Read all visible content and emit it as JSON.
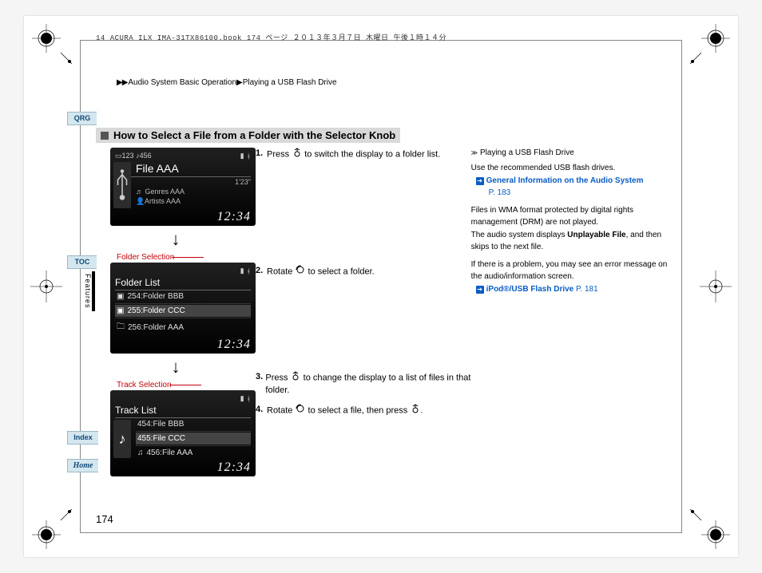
{
  "header_meta": "14 ACURA ILX IMA-31TX86100.book  174 ページ  ２０１３年３月７日  木曜日  午後１時１４分",
  "breadcrumb": {
    "arrows": "▶▶",
    "level1": "Audio System Basic Operation",
    "arrow2": "▶",
    "level2": "Playing a USB Flash Drive"
  },
  "tabs": {
    "qrg": "QRG",
    "toc": "TOC",
    "index": "Index",
    "home": "Home",
    "section_label": "Features"
  },
  "heading": "How to Select a File from a Folder with the Selector Knob",
  "steps": {
    "s1_num": "1.",
    "s1_a": "Press ",
    "s1_b": " to switch the display to a folder list.",
    "s2_num": "2.",
    "s2_a": "Rotate ",
    "s2_b": " to select a folder.",
    "s3_num": "3.",
    "s3_a": "Press ",
    "s3_b": " to change the display to a list of files in that folder.",
    "s4_num": "4.",
    "s4_a": "Rotate ",
    "s4_b": " to select a file, then press ",
    "s4_c": "."
  },
  "callouts": {
    "folder": "Folder Selection",
    "track": "Track Selection"
  },
  "screens": {
    "s1": {
      "counter_left": "123",
      "counter_right": "456",
      "file": "File AAA",
      "file_time": "1'23\"",
      "genres": "Genres AAA",
      "artists": "Artists AAA",
      "clock": "12:34"
    },
    "s2": {
      "title": "Folder List",
      "row1": "254:Folder BBB",
      "row2": "255:Folder CCC",
      "row3": "256:Folder AAA",
      "clock": "12:34"
    },
    "s3": {
      "title": "Track List",
      "row1": "454:File BBB",
      "row2": "455:File CCC",
      "row3": "456:File AAA",
      "clock": "12:34"
    }
  },
  "sidebar": {
    "caption_prefix": "Playing a USB Flash Drive",
    "para1": "Use the recommended USB flash drives.",
    "link1": "General Information on the Audio System",
    "link1_page": "P. 183",
    "para2": "Files in WMA format protected by digital rights management (DRM) are not played.",
    "para3a": "The audio system displays ",
    "para3b_bold": "Unplayable File",
    "para3c": ", and then skips to the next file.",
    "para4": "If there is a problem, you may see an error message on the audio/information screen.",
    "link2": "iPod®/USB Flash Drive",
    "link2_page": "P. 181"
  },
  "page_number": "174"
}
